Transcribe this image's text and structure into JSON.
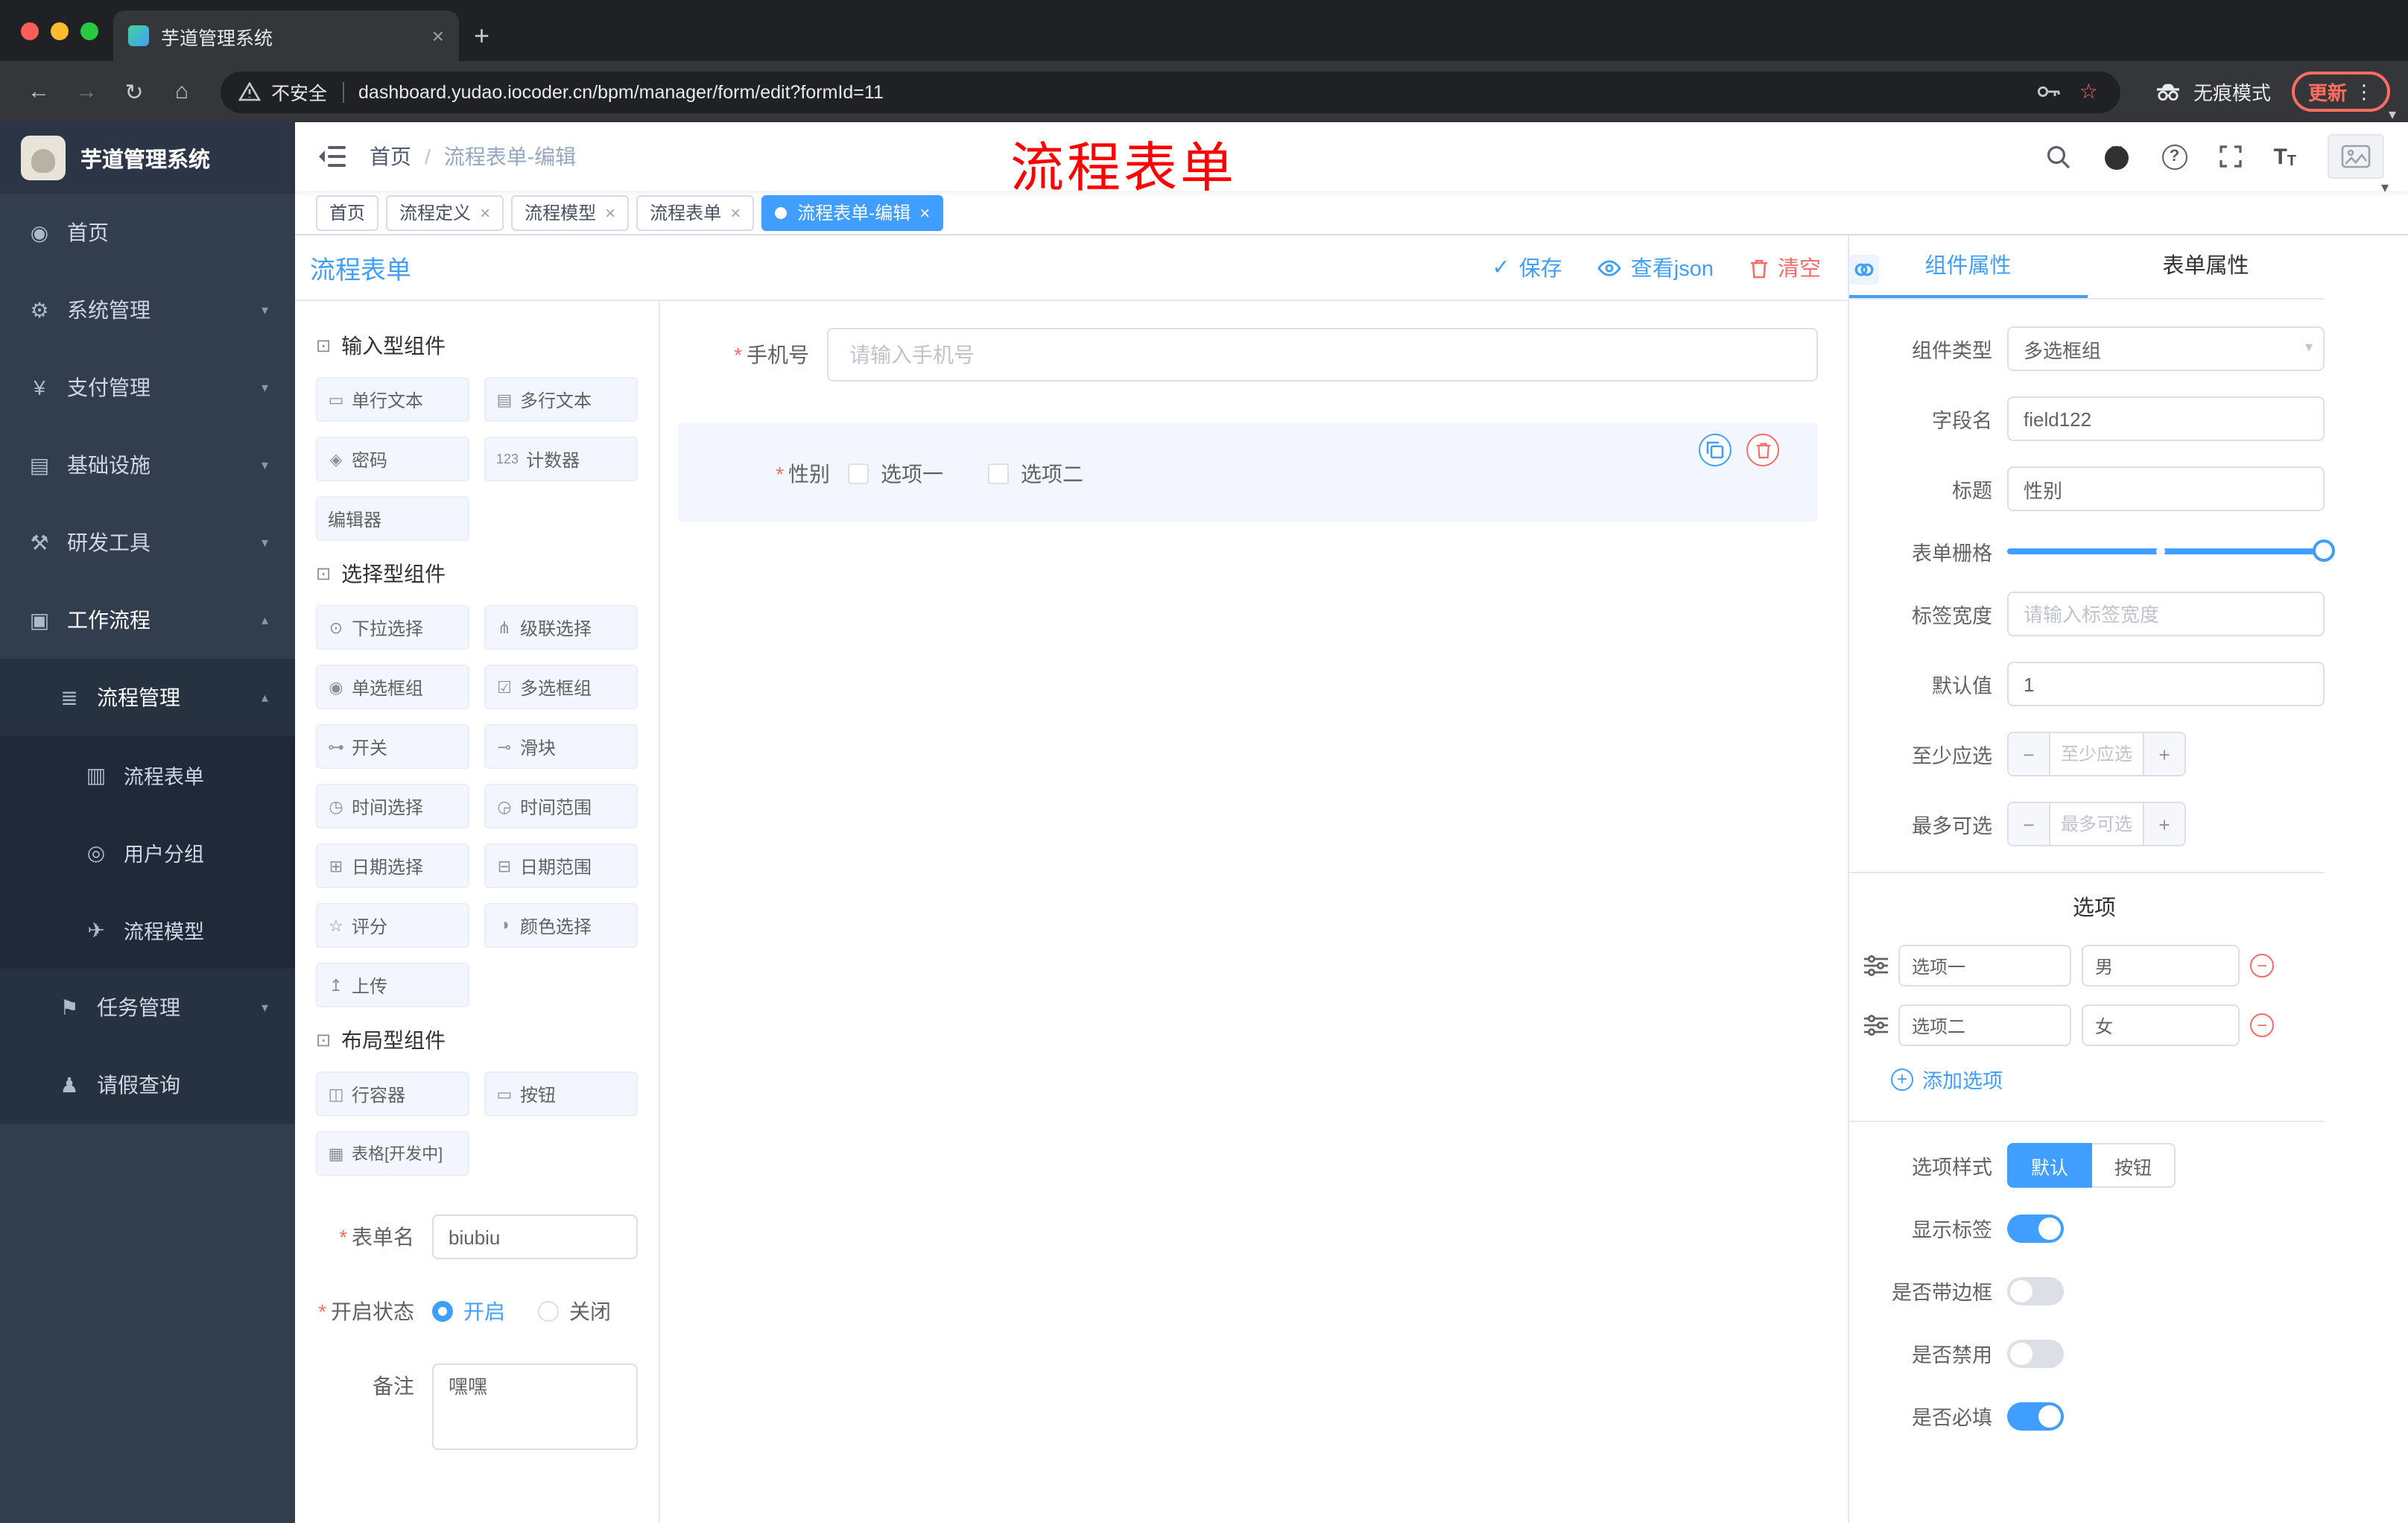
{
  "colors": {
    "accent": "#409eff",
    "danger": "#f56c6c",
    "annotation": "#fe0000",
    "update": "#ff6d60"
  },
  "glyphs": {
    "close": "×",
    "plus": "+",
    "dots": "⋮",
    "back": "←",
    "forward": "→",
    "reload": "↻",
    "home": "⌂",
    "caret_down": "▾",
    "question": "?",
    "star": "☆",
    "minus": "−",
    "add": "+",
    "check": "✓",
    "slash": "/",
    "font_big": "T",
    "font_small": "T"
  },
  "browser": {
    "tab_title": "芋道管理系统",
    "security_label": "不安全",
    "url": "dashboard.yudao.iocoder.cn/bpm/manager/form/edit?formId=11",
    "incognito_label": "无痕模式",
    "update_label": "更新"
  },
  "sidebar": {
    "logo_title": "芋道管理系统",
    "menu": [
      {
        "icon": "◉",
        "label": "首页",
        "chevron": ""
      },
      {
        "icon": "⚙",
        "label": "系统管理",
        "chevron": "▾"
      },
      {
        "icon": "¥",
        "label": "支付管理",
        "chevron": "▾"
      },
      {
        "icon": "▤",
        "label": "基础设施",
        "chevron": "▾"
      },
      {
        "icon": "⚒",
        "label": "研发工具",
        "chevron": "▾"
      },
      {
        "icon": "▣",
        "label": "工作流程",
        "chevron": "▴"
      },
      {
        "icon": "≣",
        "label": "流程管理",
        "chevron": "▴"
      },
      {
        "icon": "▥",
        "label": "流程表单",
        "chevron": ""
      },
      {
        "icon": "◎",
        "label": "用户分组",
        "chevron": ""
      },
      {
        "icon": "✈",
        "label": "流程模型",
        "chevron": ""
      },
      {
        "icon": "⚑",
        "label": "任务管理",
        "chevron": "▾"
      },
      {
        "icon": "♟",
        "label": "请假查询",
        "chevron": ""
      }
    ]
  },
  "header": {
    "breadcrumb_home": "首页",
    "breadcrumb_current": "流程表单-编辑",
    "annotation": "流程表单"
  },
  "tags": [
    {
      "label": "首页"
    },
    {
      "label": "流程定义"
    },
    {
      "label": "流程模型"
    },
    {
      "label": "流程表单"
    },
    {
      "label": "流程表单-编辑"
    }
  ],
  "designer": {
    "title": "流程表单",
    "save": "保存",
    "view_json": "查看json",
    "clear": "清空",
    "required_mark": "*",
    "groups": [
      {
        "icon": "⊡",
        "title": "输入型组件",
        "items": [
          {
            "icon": "▭",
            "label": "单行文本"
          },
          {
            "icon": "▤",
            "label": "多行文本"
          },
          {
            "icon": "◈",
            "label": "密码"
          },
          {
            "icon": "123",
            "label": "计数器"
          },
          {
            "icon": "",
            "label": "编辑器"
          }
        ]
      },
      {
        "icon": "⊡",
        "title": "选择型组件",
        "items": [
          {
            "icon": "⊙",
            "label": "下拉选择"
          },
          {
            "icon": "⋔",
            "label": "级联选择"
          },
          {
            "icon": "◉",
            "label": "单选框组"
          },
          {
            "icon": "☑",
            "label": "多选框组"
          },
          {
            "icon": "⊶",
            "label": "开关"
          },
          {
            "icon": "⊸",
            "label": "滑块"
          },
          {
            "icon": "◷",
            "label": "时间选择"
          },
          {
            "icon": "◶",
            "label": "时间范围"
          },
          {
            "icon": "⊞",
            "label": "日期选择"
          },
          {
            "icon": "⊟",
            "label": "日期范围"
          },
          {
            "icon": "☆",
            "label": "评分"
          },
          {
            "icon": "◑",
            "label": "颜色选择"
          },
          {
            "icon": "↥",
            "label": "上传"
          }
        ]
      },
      {
        "icon": "⊡",
        "title": "布局型组件",
        "items": [
          {
            "icon": "◫",
            "label": "行容器"
          },
          {
            "icon": "▭",
            "label": "按钮"
          },
          {
            "icon": "▦",
            "label": "表格[开发中]"
          }
        ]
      }
    ],
    "meta_form": {
      "name_label": "表单名",
      "name_value": "biubiu",
      "status_label": "开启状态",
      "status_on": "开启",
      "status_off": "关闭",
      "remark_label": "备注",
      "remark_value": "嘿嘿"
    },
    "canvas": {
      "phone_label": "手机号",
      "phone_placeholder": "请输入手机号",
      "gender_label": "性别",
      "gender_options": [
        "选项一",
        "选项二"
      ]
    }
  },
  "props": {
    "tab_component": "组件属性",
    "tab_form": "表单属性",
    "rows": {
      "type_label": "组件类型",
      "type_value": "多选框组",
      "field_label": "字段名",
      "field_value": "field122",
      "title_label": "标题",
      "title_value": "性别",
      "grid_label": "表单栅格",
      "label_width_label": "标签宽度",
      "label_width_placeholder": "请输入标签宽度",
      "default_label": "默认值",
      "default_value": "1",
      "min_label": "至少应选",
      "min_placeholder": "至少应选",
      "max_label": "最多可选",
      "max_placeholder": "最多可选",
      "options_title": "选项",
      "options": [
        {
          "label": "选项一",
          "value": "男"
        },
        {
          "label": "选项二",
          "value": "女"
        }
      ],
      "add_option": "添加选项",
      "style_label": "选项样式",
      "style_default": "默认",
      "style_button": "按钮",
      "show_label": "显示标签",
      "border_label": "是否带边框",
      "disabled_label": "是否禁用",
      "required_label": "是否必填"
    }
  }
}
